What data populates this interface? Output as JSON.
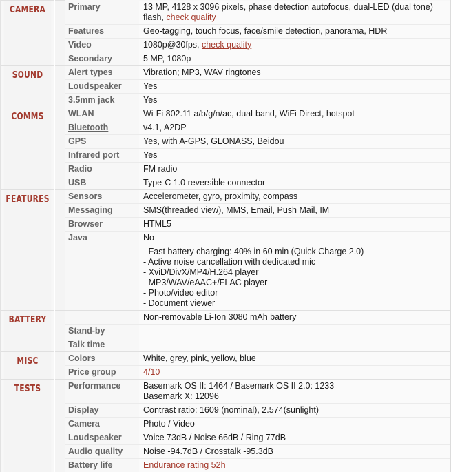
{
  "sheet": {
    "sections": [
      {
        "category": "CAMERA",
        "rows": [
          {
            "label": "Primary",
            "value": "13 MP, 4128 x 3096 pixels, phase detection autofocus, dual-LED (dual tone) flash, ",
            "link": "check quality"
          },
          {
            "label": "Features",
            "value": "Geo-tagging, touch focus, face/smile detection, panorama, HDR",
            "link": ""
          },
          {
            "label": "Video",
            "value": "1080p@30fps, ",
            "link": "check quality"
          },
          {
            "label": "Secondary",
            "value": "5 MP, 1080p",
            "link": ""
          }
        ]
      },
      {
        "category": "SOUND",
        "rows": [
          {
            "label": "Alert types",
            "value": "Vibration; MP3, WAV ringtones",
            "link": ""
          },
          {
            "label": "Loudspeaker",
            "value": "Yes",
            "link": ""
          },
          {
            "label": "3.5mm jack",
            "value": "Yes",
            "link": ""
          }
        ]
      },
      {
        "category": "COMMS",
        "rows": [
          {
            "label": "WLAN",
            "value": "Wi-Fi 802.11 a/b/g/n/ac, dual-band, WiFi Direct, hotspot",
            "link": ""
          },
          {
            "label": "Bluetooth",
            "label_is_link": true,
            "value": "v4.1, A2DP",
            "link": ""
          },
          {
            "label": "GPS",
            "value": "Yes, with A-GPS, GLONASS, Beidou",
            "link": ""
          },
          {
            "label": "Infrared port",
            "value": "Yes",
            "link": ""
          },
          {
            "label": "Radio",
            "value": "FM radio",
            "link": ""
          },
          {
            "label": "USB",
            "value": "Type-C 1.0 reversible connector",
            "link": ""
          }
        ]
      },
      {
        "category": "FEATURES",
        "rows": [
          {
            "label": "Sensors",
            "value": "Accelerometer, gyro, proximity, compass",
            "link": ""
          },
          {
            "label": "Messaging",
            "value": "SMS(threaded view), MMS, Email, Push Mail, IM",
            "link": ""
          },
          {
            "label": "Browser",
            "value": "HTML5",
            "link": ""
          },
          {
            "label": "Java",
            "value": "No",
            "link": ""
          },
          {
            "label": "",
            "value": "- Fast battery charging: 40% in 60 min (Quick Charge 2.0)\n- Active noise cancellation with dedicated mic\n- XviD/DivX/MP4/H.264 player\n- MP3/WAV/eAAC+/FLAC player\n- Photo/video editor\n- Document viewer",
            "link": ""
          }
        ]
      },
      {
        "category": "BATTERY",
        "rows": [
          {
            "label": "",
            "value": "Non-removable Li-Ion 3080 mAh battery",
            "link": ""
          },
          {
            "label": "Stand-by",
            "value": "",
            "link": ""
          },
          {
            "label": "Talk time",
            "value": "",
            "link": ""
          }
        ]
      },
      {
        "category": "MISC",
        "rows": [
          {
            "label": "Colors",
            "value": "White, grey, pink, yellow, blue",
            "link": ""
          },
          {
            "label": "Price group",
            "value": "",
            "link": "4/10"
          }
        ]
      },
      {
        "category": "TESTS",
        "rows": [
          {
            "label": "Performance",
            "value": "Basemark OS II: 1464 / Basemark OS II 2.0: 1233\nBasemark X: 12096",
            "link": ""
          },
          {
            "label": "Display",
            "value": "Contrast ratio: 1609 (nominal), 2.574(sunlight)",
            "link": ""
          },
          {
            "label": "Camera",
            "value": "Photo / Video",
            "link": ""
          },
          {
            "label": "Loudspeaker",
            "value": "Voice 73dB / Noise 66dB / Ring 77dB",
            "link": ""
          },
          {
            "label": "Audio quality",
            "value": "Noise -94.7dB / Crosstalk -95.3dB",
            "link": ""
          },
          {
            "label": "Battery life",
            "value": "",
            "link": "Endurance rating 52h"
          }
        ]
      }
    ]
  },
  "colors": {
    "category_red": "#a33a2e",
    "link_red": "#a53a2c",
    "label_gray": "#656565",
    "value_black": "#1c1c1c",
    "row_bg": "#fafafa",
    "cat_bg": "#f4f4f4",
    "divider": "#ebebeb"
  }
}
